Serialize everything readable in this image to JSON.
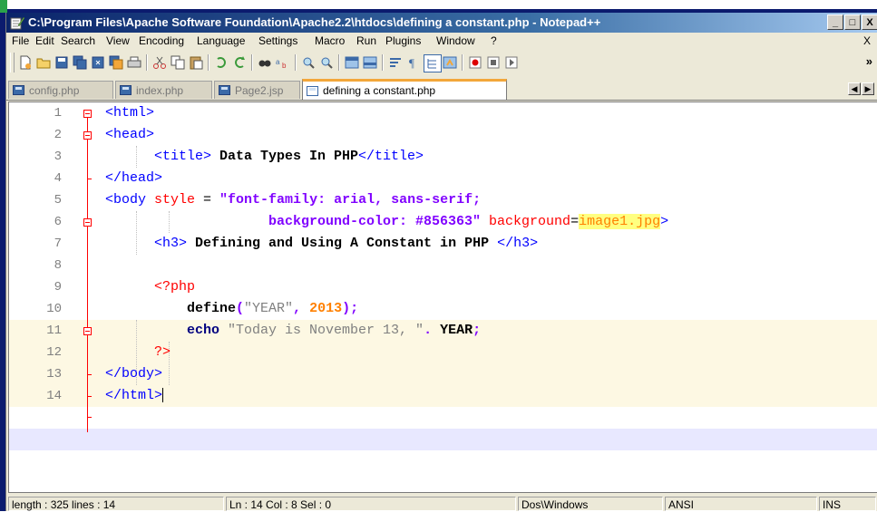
{
  "window": {
    "title": "C:\\Program Files\\Apache Software Foundation\\Apache2.2\\htdocs\\defining a constant.php - Notepad++",
    "minimize": "_",
    "maximize": "□",
    "close": "X"
  },
  "menu": {
    "items": [
      "File",
      "Edit",
      "Search",
      "View",
      "Encoding",
      "Language",
      "Settings",
      "Macro",
      "Run",
      "Plugins",
      "Window",
      "?"
    ],
    "close_doc": "X"
  },
  "toolbar": {
    "more": "»",
    "icons": [
      "new-icon",
      "open-icon",
      "save-icon",
      "save-all-icon",
      "close-icon",
      "close-all-icon",
      "print-icon",
      "cut-icon",
      "copy-icon",
      "paste-icon",
      "undo-icon",
      "redo-icon",
      "find-icon",
      "replace-icon",
      "zoom-in-icon",
      "zoom-out-icon",
      "sync-v-icon",
      "sync-h-icon",
      "word-wrap-icon",
      "show-all-chars-icon",
      "indent-guide-icon",
      "user-lang-icon",
      "record-macro-icon",
      "stop-record-icon",
      "play-macro-icon"
    ]
  },
  "tabs": [
    {
      "label": "config.php",
      "active": false
    },
    {
      "label": "index.php",
      "active": false
    },
    {
      "label": "Page2.jsp",
      "active": false
    },
    {
      "label": "defining a constant.php",
      "active": true
    }
  ],
  "tab_scroll": {
    "left": "◀",
    "right": "▶"
  },
  "editor": {
    "line_numbers": [
      "1",
      "2",
      "3",
      "4",
      "5",
      "6",
      "7",
      "8",
      "9",
      "10",
      "11",
      "12",
      "13",
      "14"
    ],
    "lines": {
      "l1": {
        "tag": "<html>"
      },
      "l2": {
        "tag": "<head>"
      },
      "l3": {
        "open": "<title>",
        "text": " Data Types In PHP",
        "close": "</title>"
      },
      "l4": {
        "tag": "</head>"
      },
      "l5": {
        "open": "<body",
        "attr": " style",
        "eq": " = ",
        "val": "\"font-family: arial, sans-serif;"
      },
      "l6": {
        "val": "background-color: #856363\"",
        "attr": " background",
        "eq": "=",
        "hl": "image1.jpg",
        "close": ">"
      },
      "l7": {
        "open": "<h3>",
        "text": " Defining and Using A Constant in PHP ",
        "close": "</h3>"
      },
      "l9": {
        "php_open": "<?php"
      },
      "l10": {
        "fn": "define",
        "paren_open": "(",
        "str": "\"YEAR\"",
        "comma": ", ",
        "num": "2013",
        "paren_close": ");"
      },
      "l11": {
        "kw": "echo",
        "str": " \"Today is November 13, \"",
        "op": ". ",
        "const": "YEAR",
        "semi": ";"
      },
      "l12": {
        "php_close": "?>"
      },
      "l13": {
        "tag": "</body>"
      },
      "l14": {
        "tag": "</html>"
      }
    }
  },
  "status": {
    "length": "length : 325   lines : 14",
    "position": "Ln : 14   Col : 8   Sel : 0",
    "eol": "Dos\\Windows",
    "encoding": "ANSI",
    "mode": "INS"
  },
  "colors": {
    "tag": "#0000ff",
    "attr": "#ff0000",
    "string": "#8000ff",
    "fold": "#ff0000",
    "current_line": "#e8e8ff"
  }
}
